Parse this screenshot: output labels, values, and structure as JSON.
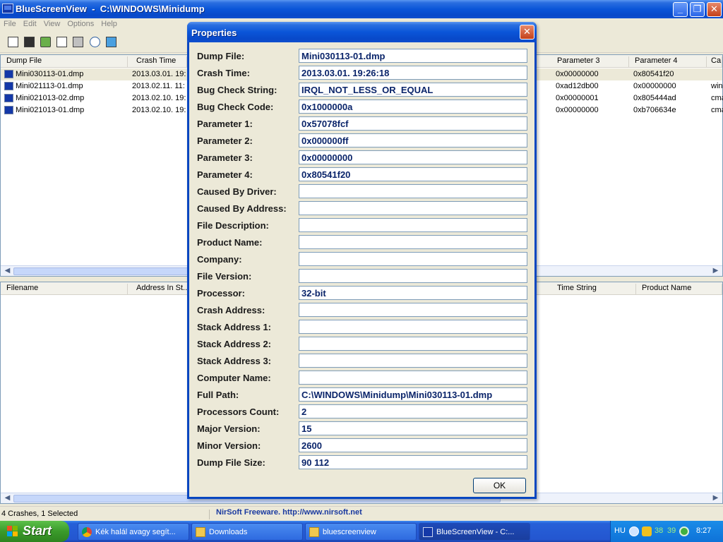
{
  "window": {
    "title": "BlueScreenView  -  C:\\WINDOWS\\Minidump",
    "minimize": "_",
    "maximize": "❐",
    "close": "✕"
  },
  "menu": [
    "File",
    "Edit",
    "View",
    "Options",
    "Help"
  ],
  "dump_list": {
    "columns_left": [
      "Dump File",
      "Crash Time"
    ],
    "columns_right": [
      "Parameter 3",
      "Parameter 4",
      "Ca"
    ],
    "rows": [
      {
        "file": "Mini030113-01.dmp",
        "time": "2013.03.01. 19:",
        "p3": "0x00000000",
        "p4": "0x80541f20",
        "ca": ""
      },
      {
        "file": "Mini021113-01.dmp",
        "time": "2013.02.11. 11:",
        "p3": "0xad12db00",
        "p4": "0x00000000",
        "ca": "win"
      },
      {
        "file": "Mini021013-02.dmp",
        "time": "2013.02.10. 19:",
        "p3": "0x00000001",
        "p4": "0x805444ad",
        "ca": "cma"
      },
      {
        "file": "Mini021013-01.dmp",
        "time": "2013.02.10. 19:",
        "p3": "0x00000000",
        "p4": "0xb706634e",
        "ca": "cma"
      }
    ]
  },
  "driver_list": {
    "columns_left": [
      "Filename",
      "Address In St..."
    ],
    "columns_right": [
      "Time String",
      "Product Name"
    ]
  },
  "status": {
    "count": "4 Crashes, 1 Selected",
    "link": "NirSoft Freeware.  http://www.nirsoft.net"
  },
  "dialog": {
    "title": "Properties",
    "close": "✕",
    "fields": [
      {
        "label": "Dump File:",
        "value": "Mini030113-01.dmp"
      },
      {
        "label": "Crash Time:",
        "value": "2013.03.01. 19:26:18"
      },
      {
        "label": "Bug Check String:",
        "value": "IRQL_NOT_LESS_OR_EQUAL"
      },
      {
        "label": "Bug Check Code:",
        "value": "0x1000000a"
      },
      {
        "label": "Parameter 1:",
        "value": "0x57078fcf"
      },
      {
        "label": "Parameter 2:",
        "value": "0x000000ff"
      },
      {
        "label": "Parameter 3:",
        "value": "0x00000000"
      },
      {
        "label": "Parameter 4:",
        "value": "0x80541f20"
      },
      {
        "label": "Caused By Driver:",
        "value": ""
      },
      {
        "label": "Caused By Address:",
        "value": ""
      },
      {
        "label": "File Description:",
        "value": ""
      },
      {
        "label": "Product Name:",
        "value": ""
      },
      {
        "label": "Company:",
        "value": ""
      },
      {
        "label": "File Version:",
        "value": ""
      },
      {
        "label": "Processor:",
        "value": "32-bit"
      },
      {
        "label": "Crash Address:",
        "value": ""
      },
      {
        "label": "Stack Address 1:",
        "value": ""
      },
      {
        "label": "Stack Address 2:",
        "value": ""
      },
      {
        "label": "Stack Address 3:",
        "value": ""
      },
      {
        "label": "Computer Name:",
        "value": ""
      },
      {
        "label": "Full Path:",
        "value": "C:\\WINDOWS\\Minidump\\Mini030113-01.dmp"
      },
      {
        "label": "Processors Count:",
        "value": "2"
      },
      {
        "label": "Major Version:",
        "value": "15"
      },
      {
        "label": "Minor Version:",
        "value": "2600"
      },
      {
        "label": "Dump File Size:",
        "value": "90 112"
      }
    ],
    "ok": "OK"
  },
  "taskbar": {
    "start": "Start",
    "tasks": [
      "Kék halál avagy segít...",
      "Downloads",
      "bluescreenview",
      "BlueScreenView  -  C:..."
    ],
    "tray": {
      "lang": "HU",
      "n1": "38",
      "n2": "39",
      "clock": "8:27"
    }
  }
}
